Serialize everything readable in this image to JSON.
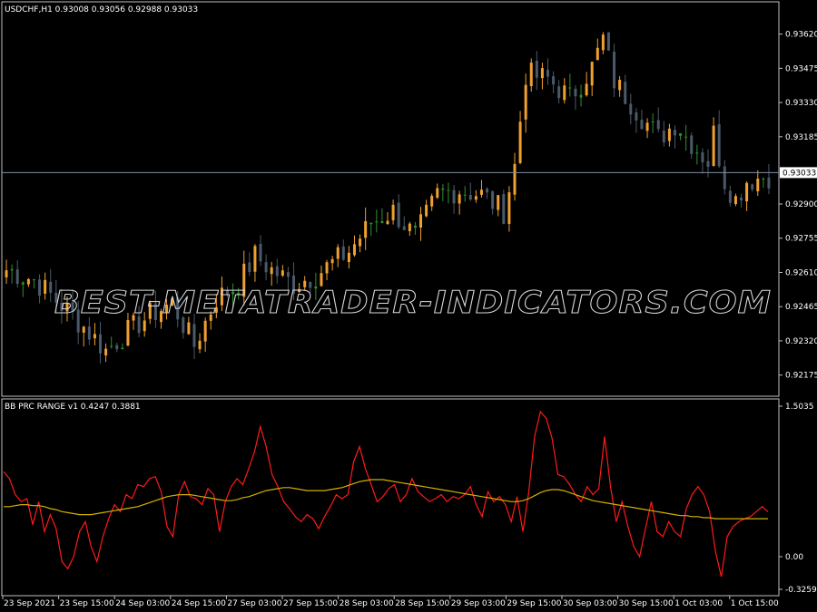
{
  "window": {
    "symbol_header": "USDCHF,H1  0.93008 0.93056 0.92988 0.93033",
    "indicator_header": "BB PRC RANGE v1  0.4247  0.3881",
    "watermark": "BEST-METATRADER-INDICATORS.COM",
    "current_price_label": "0.93033"
  },
  "colors": {
    "background": "#000000",
    "frame": "#bfbfbf",
    "bull": "#f0a030",
    "bear": "#4a5a6b",
    "bull_small": "#2f8f2f",
    "price_line": "#7f8ea3",
    "indicator_main": "#ff1a1a",
    "indicator_signal": "#d4b000",
    "text": "#ffffff"
  },
  "price_axis": {
    "labels": [
      "0.93620",
      "0.93475",
      "0.93330",
      "0.93185",
      "0.93033",
      "0.92900",
      "0.92755",
      "0.92610",
      "0.92465",
      "0.92320",
      "0.92175"
    ],
    "range": [
      0.9212,
      0.9368
    ]
  },
  "indicator_axis": {
    "labels": [
      "1.5035",
      "0.00",
      "-0.3259"
    ],
    "range": [
      -0.3259,
      1.5035
    ]
  },
  "time_axis": {
    "labels": [
      "23 Sep 2021",
      "23 Sep 15:00",
      "24 Sep 03:00",
      "24 Sep 15:00",
      "27 Sep 03:00",
      "27 Sep 15:00",
      "28 Sep 03:00",
      "28 Sep 15:00",
      "29 Sep 03:00",
      "29 Sep 15:00",
      "30 Sep 03:00",
      "30 Sep 15:00",
      "1 Oct 03:00",
      "1 Oct 15:00"
    ]
  },
  "chart_data": [
    {
      "type": "candlestick",
      "title": "USDCHF,H1",
      "ylim": [
        0.9212,
        0.9368
      ],
      "last_price": 0.93033,
      "anchors": [
        [
          0,
          0.9262
        ],
        [
          5,
          0.9258
        ],
        [
          10,
          0.9247
        ],
        [
          14,
          0.9238
        ],
        [
          18,
          0.9228
        ],
        [
          22,
          0.9236
        ],
        [
          26,
          0.9243
        ],
        [
          30,
          0.9248
        ],
        [
          34,
          0.923
        ],
        [
          38,
          0.925
        ],
        [
          42,
          0.9256
        ],
        [
          45,
          0.9268
        ],
        [
          48,
          0.9262
        ],
        [
          52,
          0.9256
        ],
        [
          56,
          0.926
        ],
        [
          62,
          0.927
        ],
        [
          66,
          0.9282
        ],
        [
          70,
          0.9287
        ],
        [
          74,
          0.9276
        ],
        [
          78,
          0.9294
        ],
        [
          82,
          0.9296
        ],
        [
          86,
          0.9294
        ],
        [
          90,
          0.9287
        ],
        [
          92,
          0.9306
        ],
        [
          94,
          0.9345
        ],
        [
          98,
          0.9343
        ],
        [
          102,
          0.9335
        ],
        [
          106,
          0.9348
        ],
        [
          108,
          0.936
        ],
        [
          110,
          0.9342
        ],
        [
          114,
          0.933
        ],
        [
          118,
          0.9318
        ],
        [
          121,
          0.9324
        ],
        [
          124,
          0.9316
        ],
        [
          127,
          0.9308
        ],
        [
          128,
          0.932
        ],
        [
          130,
          0.93
        ],
        [
          132,
          0.9292
        ],
        [
          134,
          0.93
        ],
        [
          138,
          0.9302
        ]
      ]
    },
    {
      "type": "line",
      "title": "BB PRC RANGE v1",
      "ylim": [
        -0.3259,
        1.5035
      ],
      "series": [
        {
          "name": "BB PRC RANGE v1",
          "values": [
            0.85,
            0.78,
            0.62,
            0.55,
            0.58,
            0.32,
            0.55,
            0.25,
            0.42,
            0.28,
            -0.05,
            -0.12,
            0.0,
            0.25,
            0.35,
            0.1,
            -0.05,
            0.2,
            0.38,
            0.52,
            0.45,
            0.62,
            0.58,
            0.72,
            0.7,
            0.78,
            0.8,
            0.65,
            0.3,
            0.2,
            0.62,
            0.75,
            0.6,
            0.58,
            0.52,
            0.68,
            0.62,
            0.25,
            0.55,
            0.7,
            0.78,
            0.72,
            0.88,
            1.05,
            1.3,
            1.1,
            0.82,
            0.7,
            0.55,
            0.48,
            0.4,
            0.35,
            0.42,
            0.38,
            0.28,
            0.4,
            0.5,
            0.62,
            0.58,
            0.62,
            0.95,
            1.1,
            0.88,
            0.72,
            0.55,
            0.6,
            0.68,
            0.72,
            0.55,
            0.62,
            0.78,
            0.65,
            0.6,
            0.55,
            0.58,
            0.62,
            0.55,
            0.6,
            0.58,
            0.62,
            0.7,
            0.52,
            0.4,
            0.65,
            0.55,
            0.6,
            0.52,
            0.35,
            0.6,
            0.25,
            0.65,
            1.2,
            1.45,
            1.38,
            1.18,
            0.82,
            0.8,
            0.72,
            0.62,
            0.55,
            0.7,
            0.62,
            0.68,
            1.2,
            0.7,
            0.35,
            0.55,
            0.3,
            0.1,
            0.0,
            0.28,
            0.55,
            0.25,
            0.2,
            0.35,
            0.25,
            0.2,
            0.48,
            0.62,
            0.7,
            0.62,
            0.45,
            0.05,
            -0.2,
            0.2,
            0.3,
            0.35,
            0.38,
            0.4,
            0.45,
            0.5,
            0.45
          ]
        },
        {
          "name": "signal",
          "values": [
            0.5,
            0.5,
            0.51,
            0.52,
            0.52,
            0.51,
            0.51,
            0.5,
            0.48,
            0.47,
            0.45,
            0.44,
            0.43,
            0.42,
            0.42,
            0.42,
            0.43,
            0.44,
            0.45,
            0.46,
            0.47,
            0.48,
            0.49,
            0.5,
            0.52,
            0.54,
            0.56,
            0.58,
            0.6,
            0.61,
            0.62,
            0.62,
            0.62,
            0.61,
            0.6,
            0.59,
            0.58,
            0.57,
            0.56,
            0.56,
            0.57,
            0.59,
            0.6,
            0.62,
            0.64,
            0.66,
            0.67,
            0.68,
            0.69,
            0.69,
            0.68,
            0.67,
            0.66,
            0.66,
            0.66,
            0.66,
            0.67,
            0.68,
            0.69,
            0.71,
            0.73,
            0.75,
            0.76,
            0.77,
            0.77,
            0.77,
            0.76,
            0.75,
            0.74,
            0.73,
            0.72,
            0.71,
            0.7,
            0.69,
            0.68,
            0.67,
            0.66,
            0.65,
            0.64,
            0.63,
            0.62,
            0.61,
            0.6,
            0.59,
            0.58,
            0.57,
            0.56,
            0.55,
            0.55,
            0.56,
            0.58,
            0.61,
            0.64,
            0.66,
            0.67,
            0.67,
            0.66,
            0.64,
            0.62,
            0.6,
            0.58,
            0.56,
            0.55,
            0.54,
            0.53,
            0.52,
            0.51,
            0.5,
            0.49,
            0.48,
            0.47,
            0.46,
            0.45,
            0.44,
            0.43,
            0.42,
            0.41,
            0.41,
            0.4,
            0.4,
            0.39,
            0.39,
            0.38,
            0.38,
            0.38,
            0.38,
            0.38,
            0.38,
            0.38,
            0.38,
            0.38,
            0.38
          ]
        }
      ]
    }
  ]
}
